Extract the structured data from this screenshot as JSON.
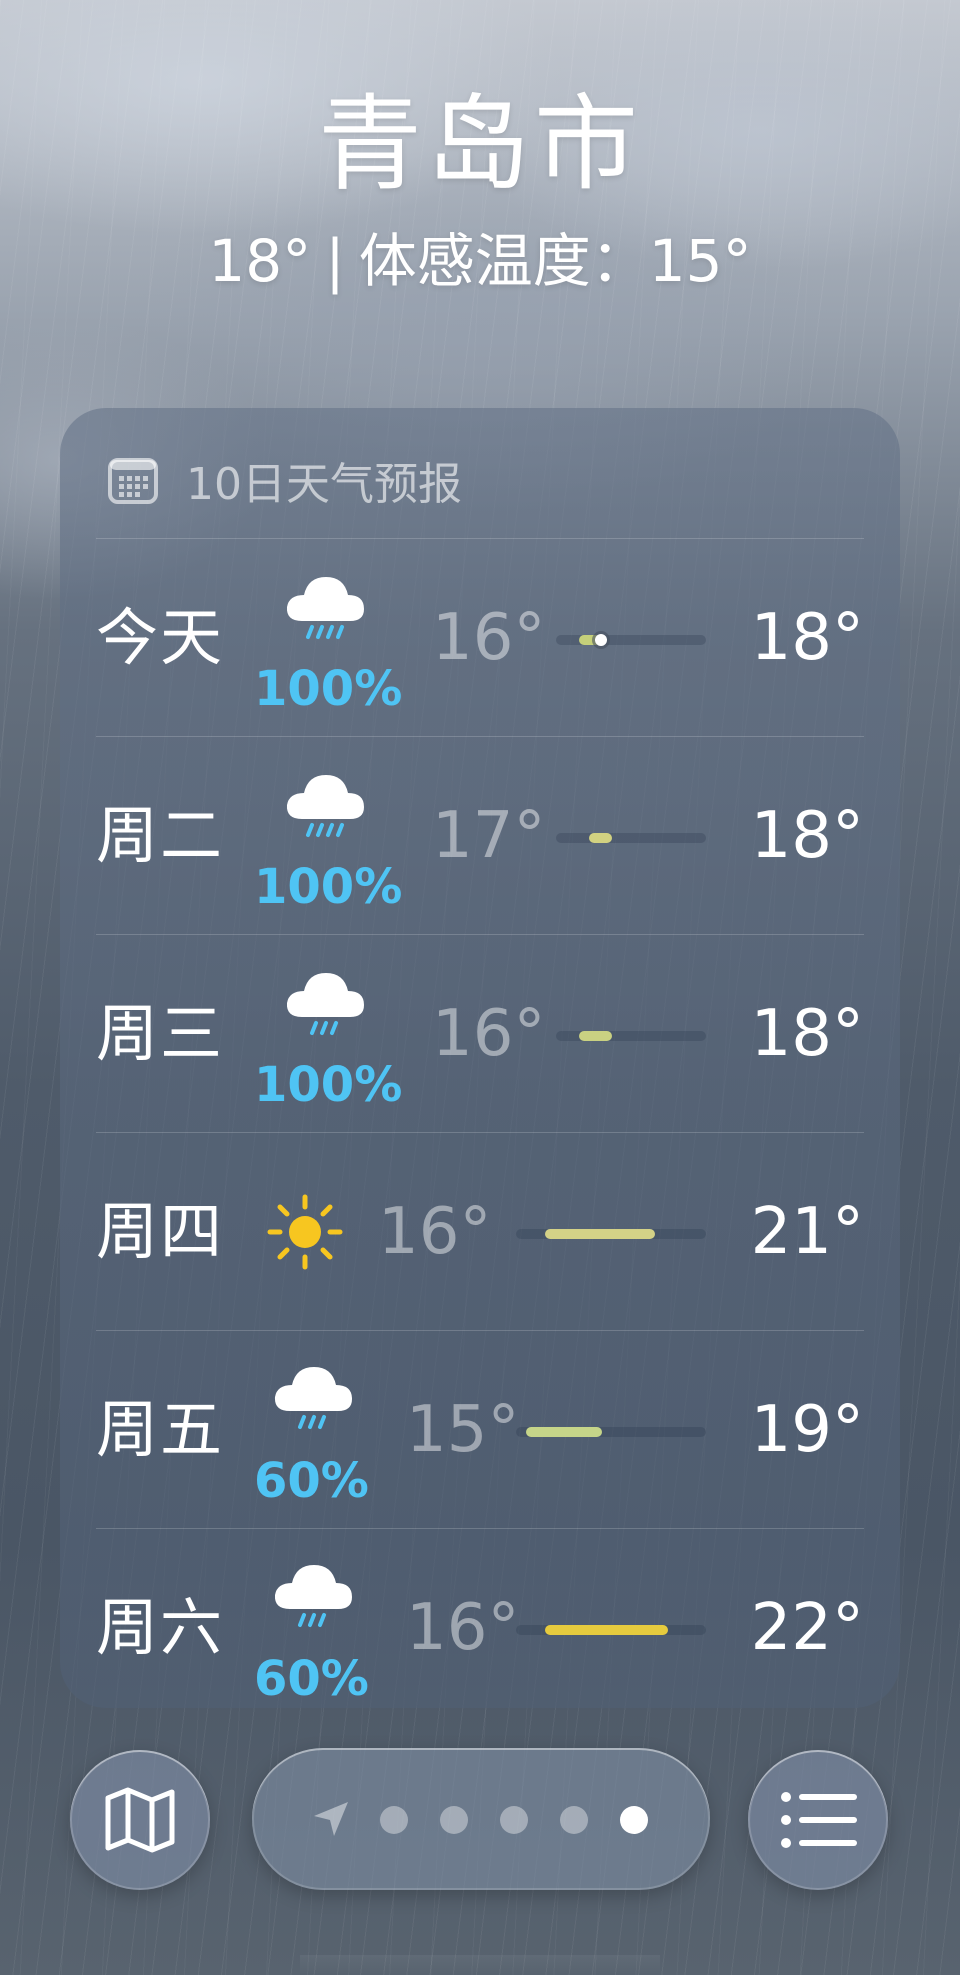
{
  "city": "青岛市",
  "current_temp": "18°",
  "separator": "|",
  "feels_like_label": "体感温度：",
  "feels_like_temp": "15°",
  "forecast": {
    "title": "10日天气预报",
    "icon": "calendar-icon",
    "days": [
      {
        "day": "今天",
        "icon": "cloud-rain-icon",
        "precip": "100%",
        "low": "16°",
        "high": "18°",
        "range_start": 0.15,
        "range_end": 0.3,
        "current_pos": 0.3,
        "bar_color": "#c5d07a"
      },
      {
        "day": "周二",
        "icon": "cloud-rain-icon",
        "precip": "100%",
        "low": "17°",
        "high": "18°",
        "range_start": 0.22,
        "range_end": 0.37,
        "bar_color": "#d2d281"
      },
      {
        "day": "周三",
        "icon": "cloud-rain-icon",
        "precip": "100%",
        "low": "16°",
        "high": "18°",
        "range_start": 0.15,
        "range_end": 0.37,
        "bar_color": "#c9d182"
      },
      {
        "day": "周四",
        "icon": "sun-icon",
        "precip": "",
        "low": "16°",
        "high": "21°",
        "range_start": 0.15,
        "range_end": 0.73,
        "bar_color": "#d4d287"
      },
      {
        "day": "周五",
        "icon": "cloud-rain-icon",
        "precip": "60%",
        "low": "15°",
        "high": "19°",
        "range_start": 0.05,
        "range_end": 0.45,
        "bar_color": "#c6d589"
      },
      {
        "day": "周六",
        "icon": "cloud-rain-icon",
        "precip": "60%",
        "low": "16°",
        "high": "22°",
        "range_start": 0.15,
        "range_end": 0.8,
        "bar_color": "#e6cb3e"
      }
    ]
  },
  "toolbar": {
    "map_icon": "map-icon",
    "list_icon": "list-icon",
    "location_icon": "location-arrow-icon",
    "page_count": 5,
    "active_page": 5
  }
}
